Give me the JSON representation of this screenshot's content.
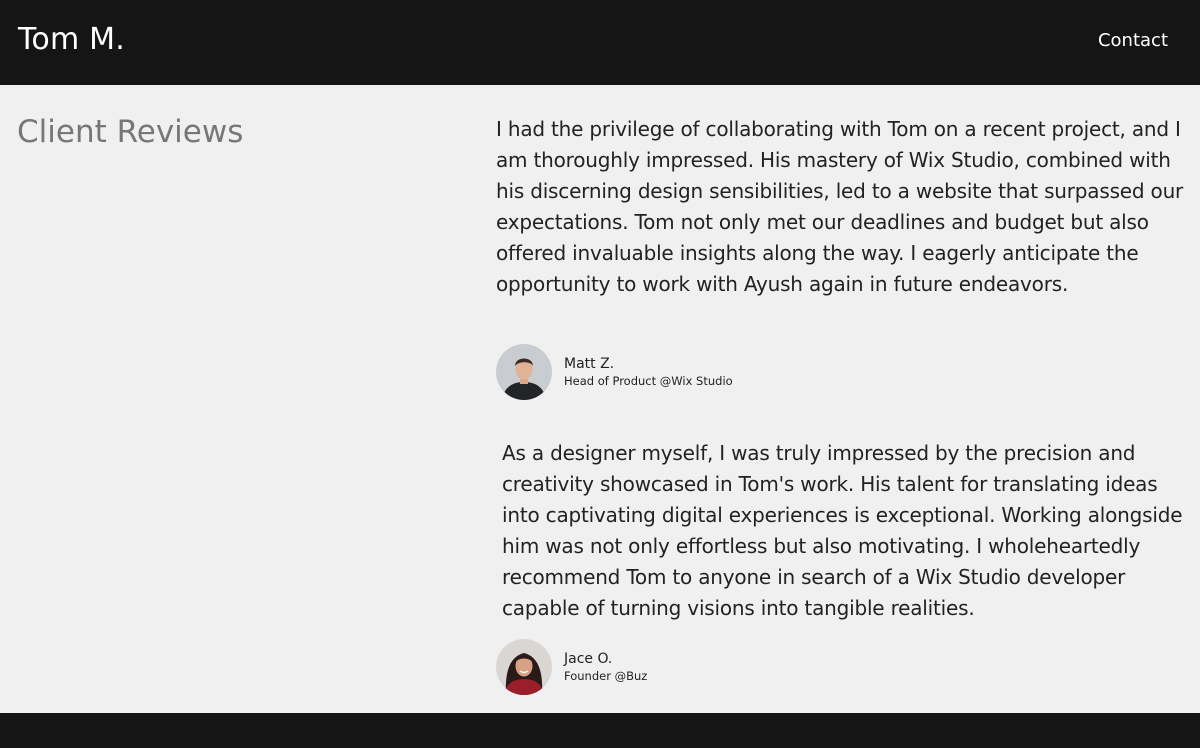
{
  "header": {
    "brand": "Tom M.",
    "nav_contact": "Contact"
  },
  "section": {
    "title": "Client Reviews"
  },
  "reviews": [
    {
      "text": "I had the privilege of collaborating with Tom on a recent project, and I am thoroughly impressed. His mastery of Wix Studio, combined with his discerning design sensibilities, led to a website that surpassed our expectations. Tom not only met our deadlines and budget but also offered invaluable insights along the way. I eagerly anticipate the opportunity to work with Ayush again in future endeavors.",
      "author_name": "Matt Z.",
      "author_role": "Head of Product @Wix Studio"
    },
    {
      "text": "As a designer myself, I was truly impressed by the precision and creativity showcased in Tom's work. His talent for translating ideas into captivating digital experiences is exceptional. Working alongside him was not only effortless but also motivating. I wholeheartedly recommend Tom to anyone in search of a Wix Studio developer capable of turning visions into tangible realities.",
      "author_name": "Jace O.",
      "author_role": "Founder @Buz"
    }
  ],
  "colors": {
    "header_bg": "#151515",
    "page_bg": "#f0f0f0",
    "title_gray": "#777777",
    "text_dark": "#222222"
  }
}
